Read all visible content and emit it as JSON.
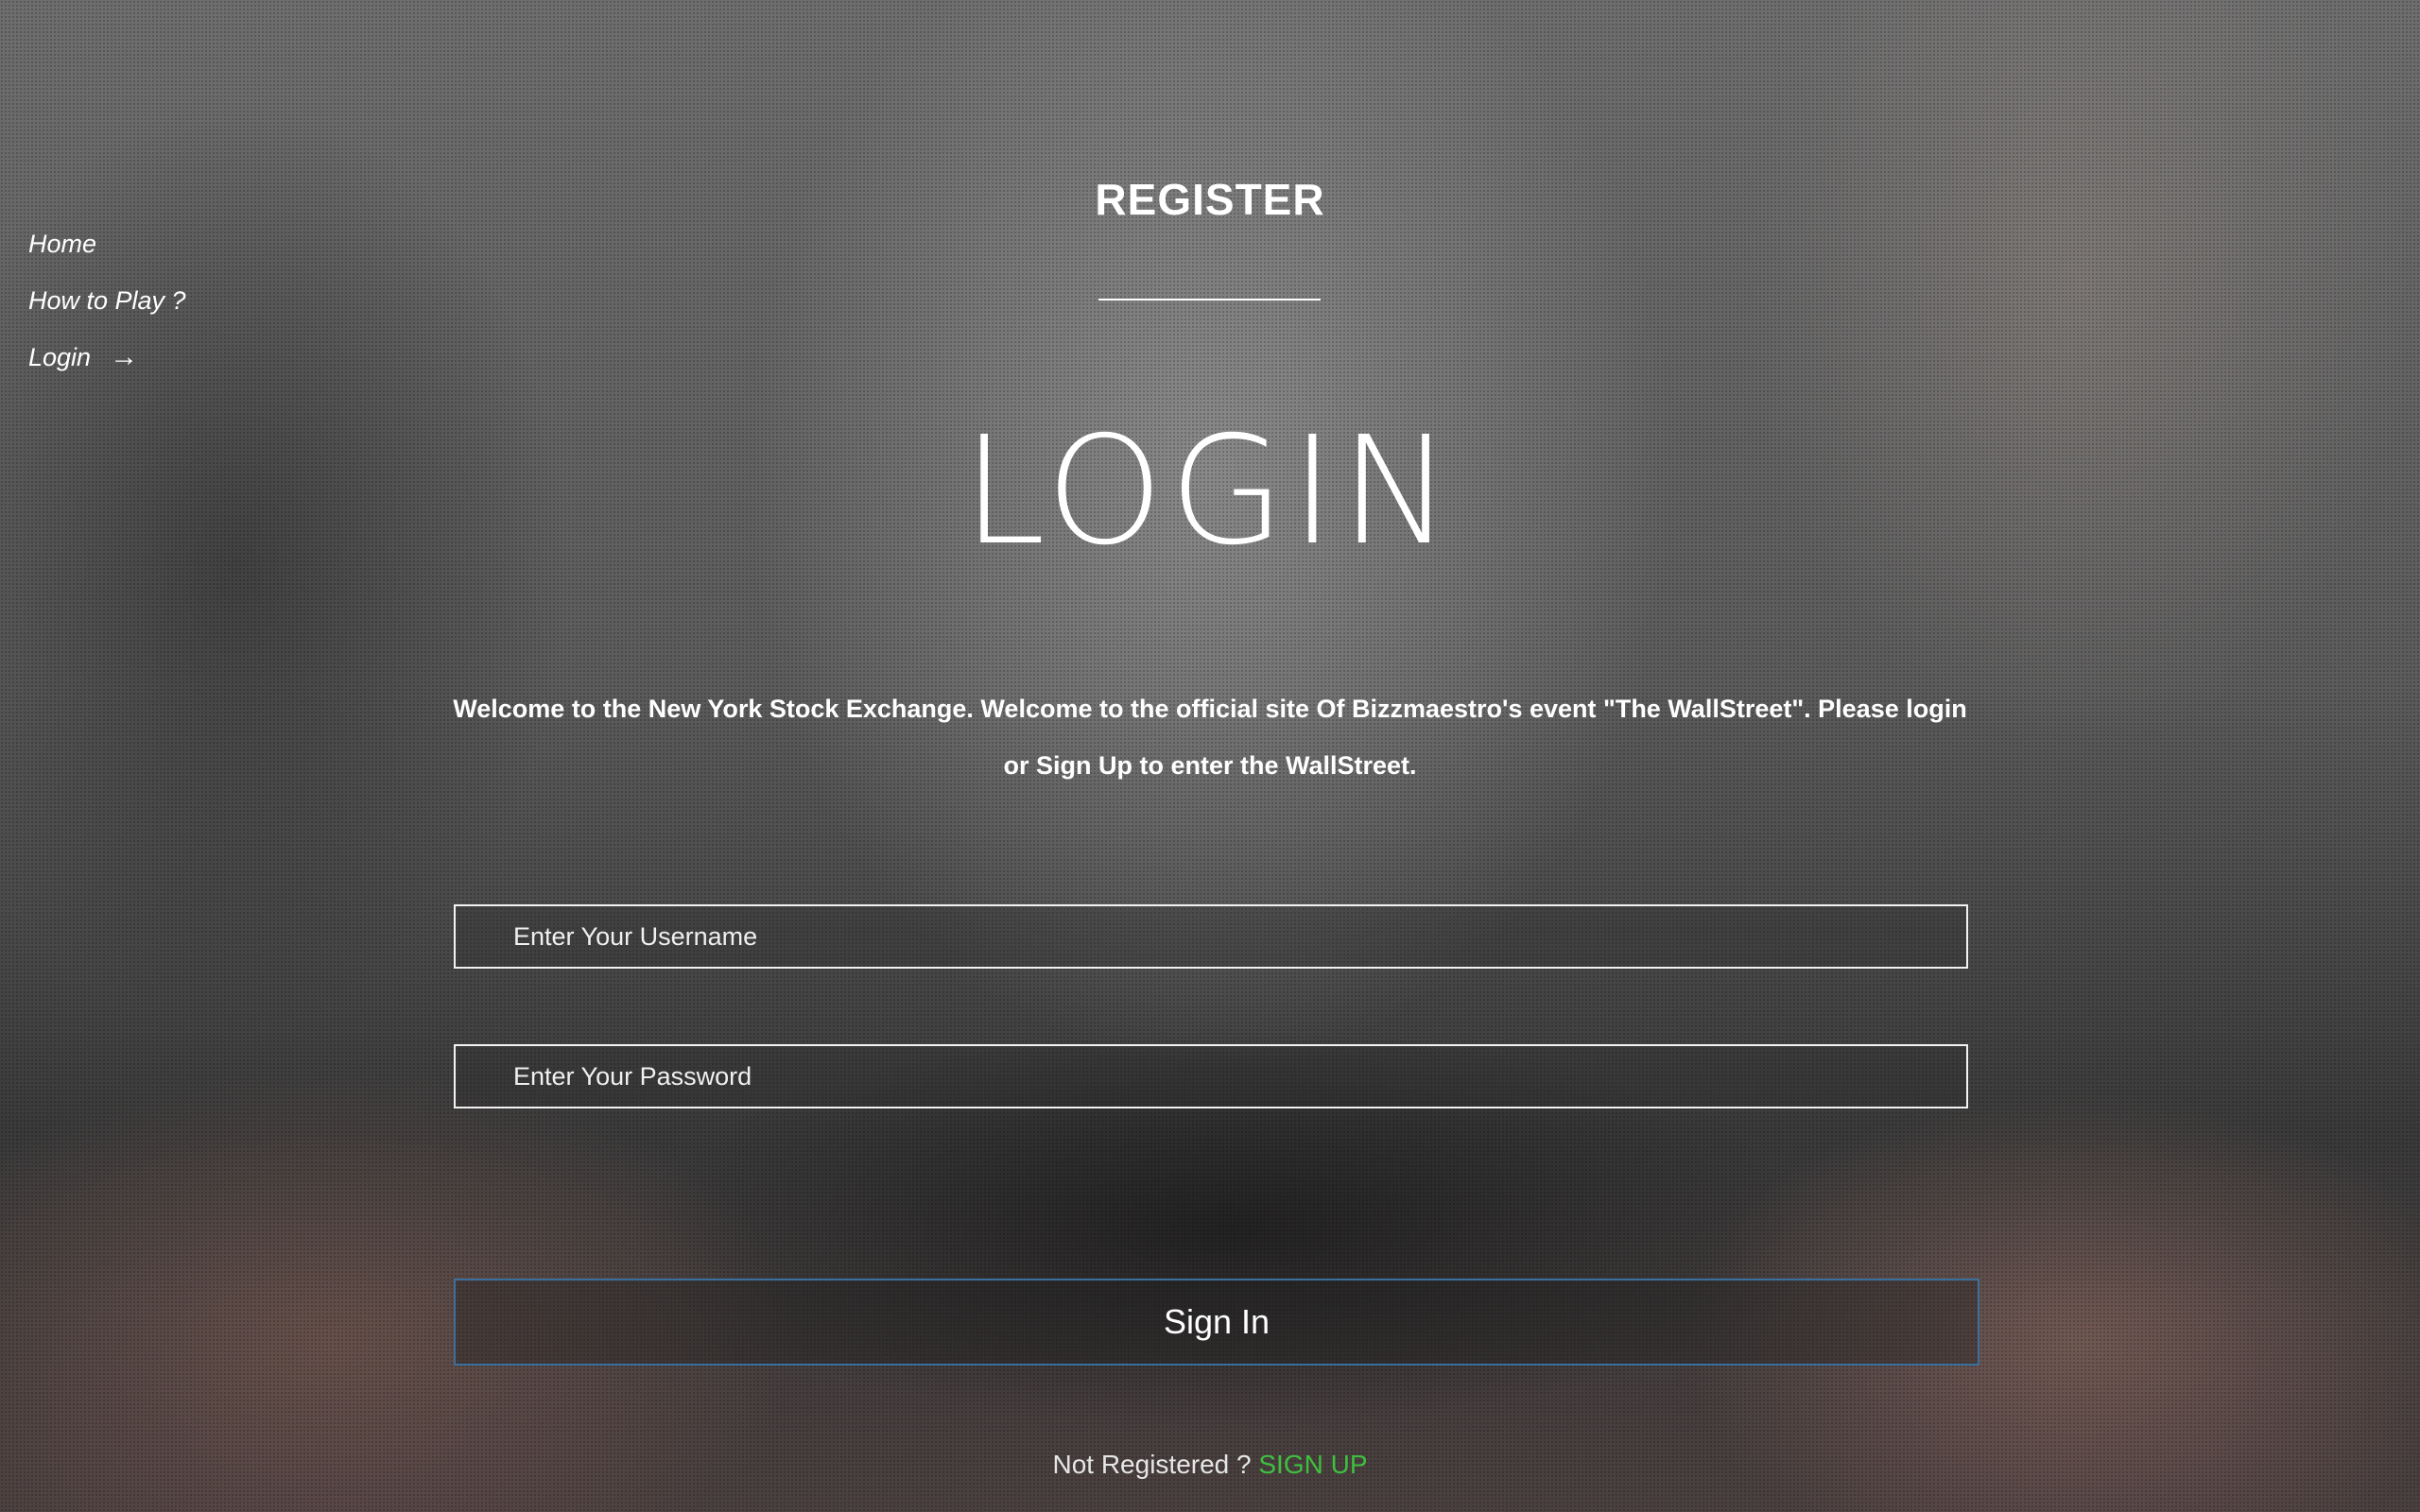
{
  "nav": {
    "items": [
      {
        "label": "Home"
      },
      {
        "label": "How to Play ?"
      },
      {
        "label": "Login",
        "icon": "arrow-right-icon"
      }
    ]
  },
  "header": {
    "register_label": "REGISTER"
  },
  "main": {
    "title": "LOGIN",
    "welcome_text": "Welcome to the New York Stock Exchange. Welcome to the official site Of Bizzmaestro's event \"The WallStreet\". Please login or Sign Up to enter the WallStreet."
  },
  "form": {
    "username": {
      "placeholder": "Enter Your Username",
      "value": ""
    },
    "password": {
      "placeholder": "Enter Your Password",
      "value": ""
    },
    "submit_label": "Sign In"
  },
  "footer": {
    "prompt": "Not Registered ? ",
    "signup_label": "SIGN UP"
  },
  "colors": {
    "signup_link": "#3fbf3f",
    "signin_border": "#3b6f9e"
  }
}
